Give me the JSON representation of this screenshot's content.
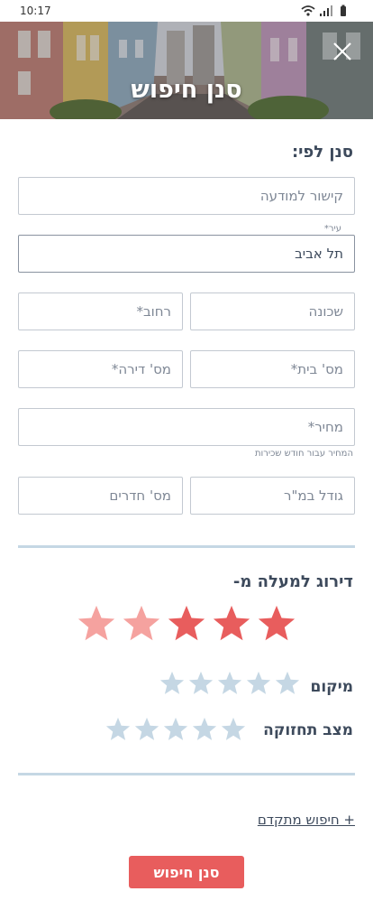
{
  "status_bar": {
    "time": "10:17"
  },
  "header": {
    "title": "סנן חיפוש"
  },
  "filter": {
    "section_title": "סנן לפי:",
    "fields": {
      "ad_link": {
        "placeholder": "קישור למודעה"
      },
      "city": {
        "label": "עיר*",
        "value": "תל אביב"
      },
      "neighborhood": {
        "placeholder": "שכונה"
      },
      "street": {
        "placeholder": "רחוב*"
      },
      "house_number": {
        "placeholder": "מס' בית*"
      },
      "apartment_number": {
        "placeholder": "מס' דירה*"
      },
      "price": {
        "placeholder": "מחיר*",
        "helper": "המחיר עבור חודש שכירות"
      },
      "size": {
        "placeholder": "גודל במ\"ר"
      },
      "rooms": {
        "placeholder": "מס' חדרים"
      }
    }
  },
  "rating": {
    "title": "דירוג למעלה מ-",
    "overall": {
      "value": 3,
      "max": 5
    },
    "location": {
      "label": "מיקום",
      "value": 0,
      "max": 5
    },
    "maintenance": {
      "label": "מצב תחזוקה",
      "value": 0,
      "max": 5
    }
  },
  "advanced_search_label": "+ חיפוש מתקדם",
  "submit_label": "סנן חיפוש",
  "colors": {
    "accent": "#e85d5d",
    "star_filled": "#e85d5d",
    "star_light": "#f5a29f",
    "star_inactive": "#c5d7e4",
    "text": "#3d4a5c",
    "divider": "#c5d7e4"
  }
}
